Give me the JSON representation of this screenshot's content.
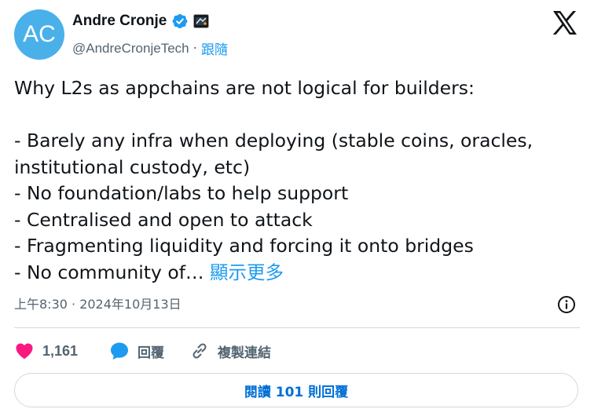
{
  "author": {
    "avatar_initials": "AC",
    "display_name": "Andre Cronje",
    "handle": "@AndreCronjeTech",
    "separator": "·",
    "follow_label": "跟隨"
  },
  "tweet": {
    "text": "Why L2s as appchains are not logical for builders:\n\n- Barely any infra when deploying (stable coins, oracles, institutional custody, etc)\n- No foundation/labs to help support\n- Centralised and open to attack\n- Fragmenting liquidity and forcing it onto bridges\n- No community of… ",
    "show_more_label": "顯示更多",
    "timestamp": "上午8:30 · 2024年10月13日"
  },
  "actions": {
    "like_count": "1,161",
    "reply_label": "回覆",
    "copy_link_label": "複製連結"
  },
  "read_replies_label": "閱讀 101 則回覆",
  "colors": {
    "accent": "#1d9bf0",
    "like": "#f91880",
    "muted": "#536471",
    "avatar": "#4ab0ea"
  },
  "icons": [
    "verified-badge-icon",
    "affiliate-badge-icon",
    "x-logo-icon",
    "info-icon",
    "heart-icon",
    "reply-bubble-icon",
    "link-icon"
  ]
}
